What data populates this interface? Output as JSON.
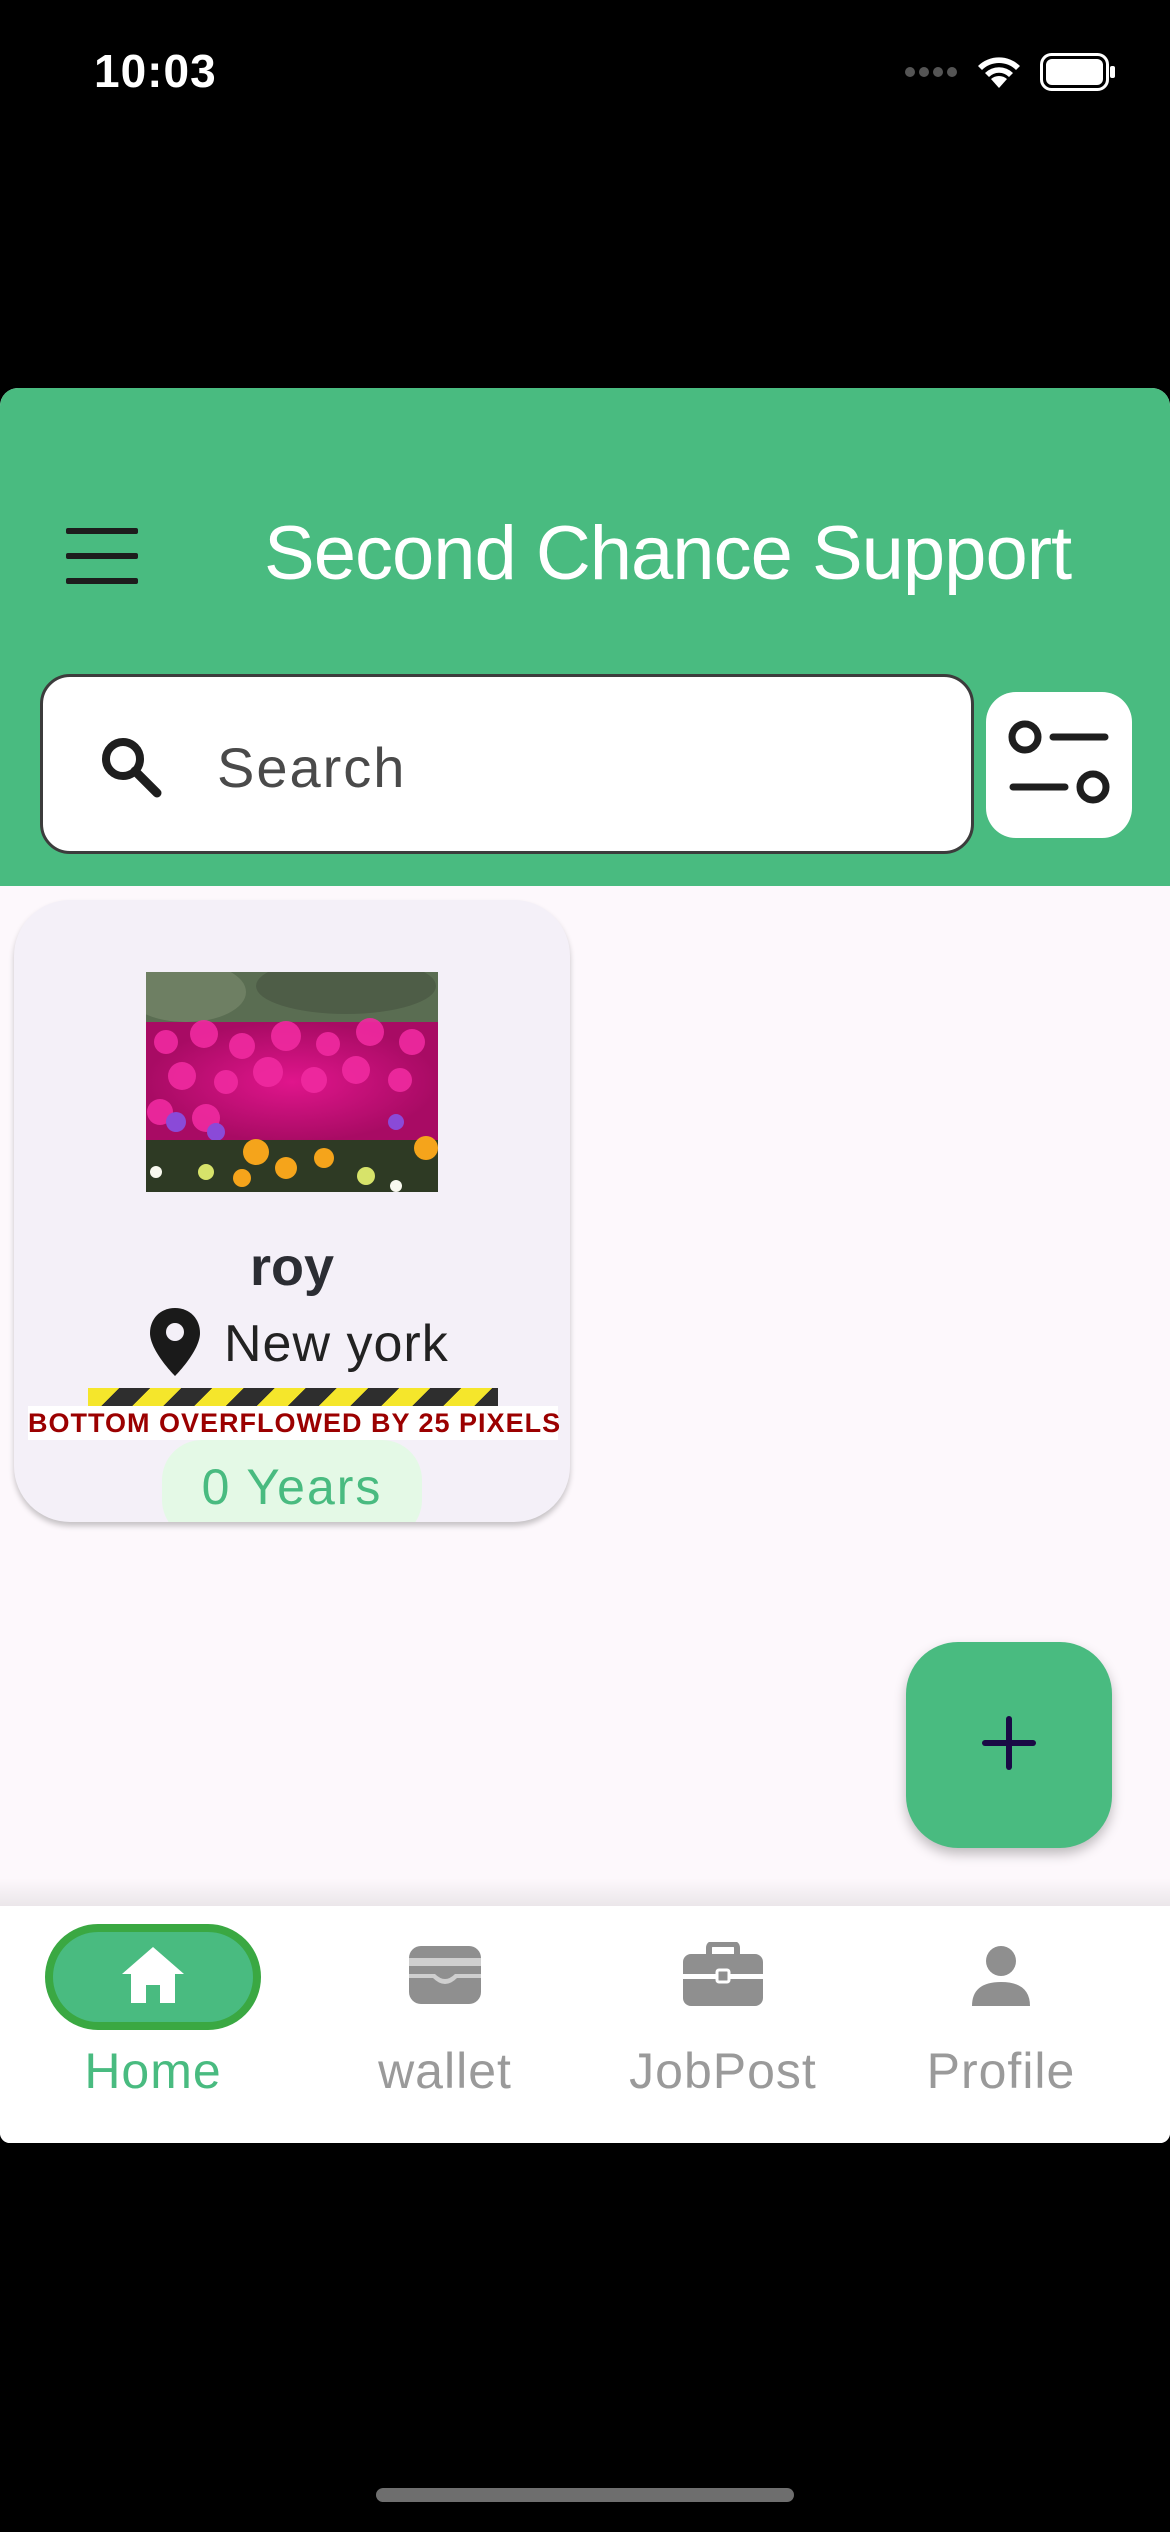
{
  "status_bar": {
    "time": "10:03"
  },
  "header": {
    "title": "Second Chance Support"
  },
  "search": {
    "placeholder": "Search"
  },
  "card": {
    "name": "roy",
    "location": "New york",
    "overflow_warning": "BOTTOM OVERFLOWED BY 25 PIXELS",
    "experience": "0 Years"
  },
  "bottom_nav": {
    "items": [
      {
        "label": "Home",
        "icon": "home-icon",
        "active": true
      },
      {
        "label": "wallet",
        "icon": "wallet-icon",
        "active": false
      },
      {
        "label": "JobPost",
        "icon": "briefcase-icon",
        "active": false
      },
      {
        "label": "Profile",
        "icon": "person-icon",
        "active": false
      }
    ]
  },
  "colors": {
    "primary": "#49bb80",
    "active_border": "#3aa842",
    "background": "#fdf8fc",
    "card": "#f4f0f8",
    "inactive": "#9a9a9a",
    "overflow_text": "#9b0000"
  }
}
